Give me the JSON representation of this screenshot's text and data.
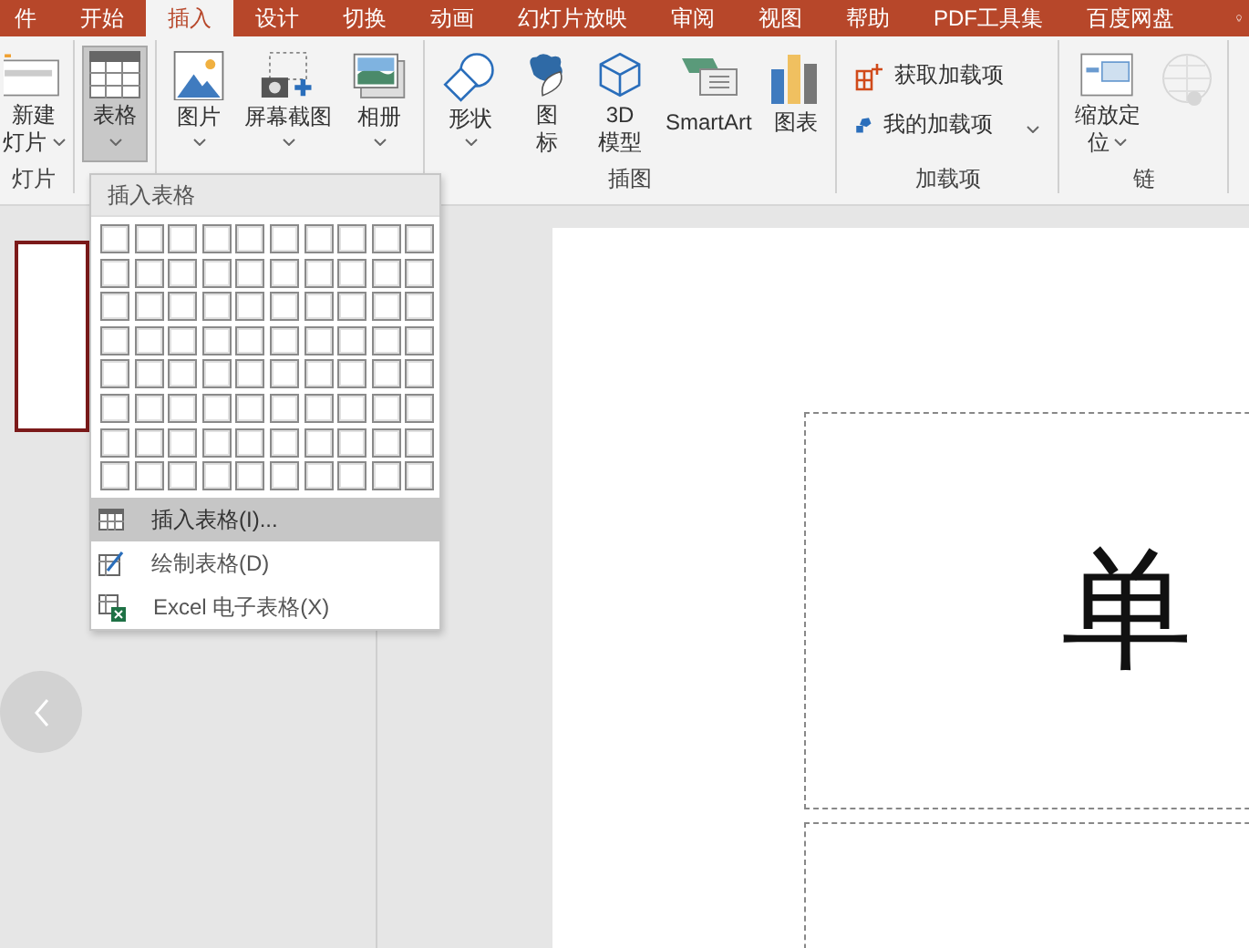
{
  "tabs": [
    {
      "label": "件",
      "selected": false
    },
    {
      "label": "开始",
      "selected": false
    },
    {
      "label": "插入",
      "selected": true
    },
    {
      "label": "设计",
      "selected": false
    },
    {
      "label": "切换",
      "selected": false
    },
    {
      "label": "动画",
      "selected": false
    },
    {
      "label": "幻灯片放映",
      "selected": false
    },
    {
      "label": "审阅",
      "selected": false
    },
    {
      "label": "视图",
      "selected": false
    },
    {
      "label": "帮助",
      "selected": false
    },
    {
      "label": "PDF工具集",
      "selected": false
    },
    {
      "label": "百度网盘",
      "selected": false
    }
  ],
  "ribbon": {
    "groups": [
      {
        "label": "灯片",
        "buttons": [
          {
            "kind": "large",
            "lines": [
              "新建",
              "灯片"
            ],
            "dropdown": true,
            "selected": false
          }
        ]
      },
      {
        "buttons": [
          {
            "kind": "large",
            "lines": [
              "表格"
            ],
            "dropdown": true,
            "selected": true
          }
        ]
      },
      {
        "buttons": [
          {
            "kind": "large",
            "lines": [
              "图片"
            ],
            "dropdown": true,
            "selected": false
          },
          {
            "kind": "large",
            "lines": [
              "屏幕截图"
            ],
            "dropdown": true,
            "selected": false
          },
          {
            "kind": "large",
            "lines": [
              "相册"
            ],
            "dropdown": true,
            "selected": false
          }
        ]
      },
      {
        "label": "插图",
        "buttons": [
          {
            "kind": "large",
            "lines": [
              "形状"
            ],
            "dropdown": true,
            "selected": false
          },
          {
            "kind": "large",
            "lines": [
              "图",
              "标"
            ],
            "dropdown": false,
            "selected": false
          },
          {
            "kind": "large",
            "lines": [
              "3D",
              "模型"
            ],
            "dropdown": false,
            "selected": false
          },
          {
            "kind": "large",
            "lines": [
              "SmartArt"
            ],
            "dropdown": false,
            "selected": false
          },
          {
            "kind": "large",
            "lines": [
              "图表"
            ],
            "dropdown": false,
            "selected": false
          }
        ]
      },
      {
        "label": "加载项",
        "buttons": [
          {
            "kind": "small",
            "lines": [
              "获取加载项"
            ],
            "dropdown": false,
            "selected": false
          },
          {
            "kind": "small",
            "lines": [
              "我的加载项"
            ],
            "dropdown": true,
            "selected": false
          }
        ]
      },
      {
        "label": "链",
        "buttons": [
          {
            "kind": "large",
            "lines": [
              "缩放定",
              "位"
            ],
            "dropdown": true,
            "selected": false
          },
          {
            "kind": "large",
            "disabled": true,
            "dropdown": false,
            "selected": false
          }
        ]
      }
    ]
  },
  "table_menu": {
    "title": "插入表格",
    "items": [
      {
        "label": "插入表格(I)...",
        "selected": true
      },
      {
        "label": "绘制表格(D)",
        "selected": false
      },
      {
        "label": "Excel 电子表格(X)",
        "selected": false
      }
    ]
  },
  "slide_pane": {
    "thumbnails": [
      {
        "selected": true
      }
    ]
  },
  "slide": {
    "title_text": "单"
  }
}
